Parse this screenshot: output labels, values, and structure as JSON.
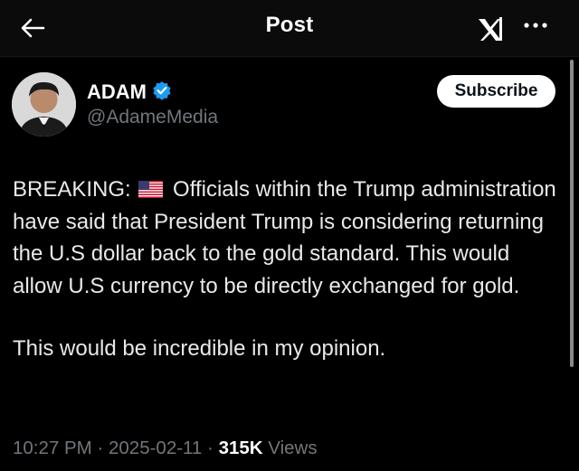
{
  "header": {
    "title": "Post",
    "back_icon": "arrow-left-icon",
    "grok_icon": "grok-icon",
    "more_icon": "more-horizontal-icon"
  },
  "author": {
    "display_name": "ADAM",
    "verified_icon": "verified-badge-icon",
    "verified_color": "#1d9bf0",
    "handle": "@AdameMedia",
    "subscribe_label": "Subscribe"
  },
  "post": {
    "prefix": "BREAKING:",
    "flag_icon": "us-flag-icon",
    "paragraph1_rest": "Officials within the Trump administration have said that President Trump is considering returning the U.S dollar back to the gold standard. This would allow U.S currency to be directly exchanged for gold.",
    "paragraph2": "This would be incredible in my opinion."
  },
  "meta": {
    "time": "10:27 PM",
    "separator": "·",
    "date": "2025-02-11",
    "views_count": "315K",
    "views_label": "Views"
  },
  "colors": {
    "background": "#000000",
    "text": "#e7e9ea",
    "secondary_text": "#71767b",
    "accent": "#1d9bf0"
  }
}
